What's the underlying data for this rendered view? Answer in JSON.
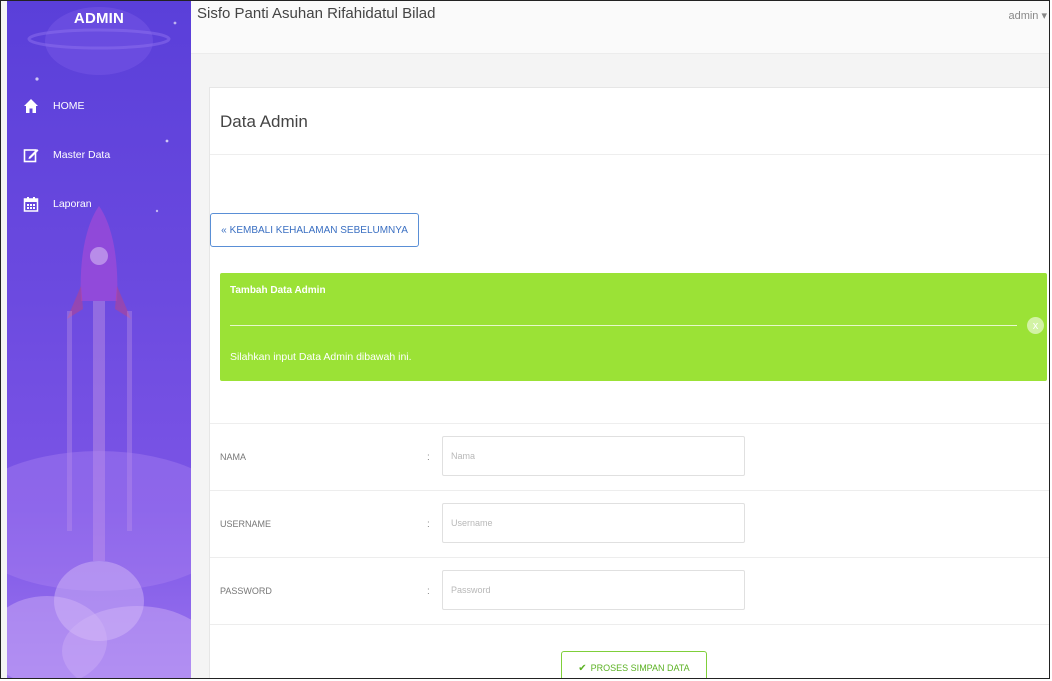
{
  "sidebar": {
    "brand": "ADMIN",
    "items": [
      {
        "label": "HOME",
        "icon": "home-icon"
      },
      {
        "label": "Master Data",
        "icon": "edit-icon"
      },
      {
        "label": "Laporan",
        "icon": "calendar-icon"
      }
    ]
  },
  "header": {
    "title": "Sisfo Panti Asuhan Rifahidatul Bilad",
    "user_menu": "admin ▾"
  },
  "panel": {
    "heading": "Data Admin",
    "back_button": "KEMBALI KEHALAMAN SEBELUMNYA",
    "alert": {
      "title": "Tambah Data Admin",
      "message": "Silahkan input Data Admin dibawah ini.",
      "close": "x"
    },
    "form": {
      "fields": [
        {
          "label": "NAMA",
          "colon": ":",
          "placeholder": "Nama"
        },
        {
          "label": "USERNAME",
          "colon": ":",
          "placeholder": "Username"
        },
        {
          "label": "PASSWORD",
          "colon": ":",
          "placeholder": "Password"
        }
      ],
      "submit": "PROSES SIMPAN DATA"
    }
  },
  "colors": {
    "sidebar_top": "#5a3fd9",
    "sidebar_bottom": "#9a74ef",
    "alert_bg": "#9be236",
    "back_button_border": "#5a8fd6",
    "submit_border": "#7fcf3a"
  }
}
